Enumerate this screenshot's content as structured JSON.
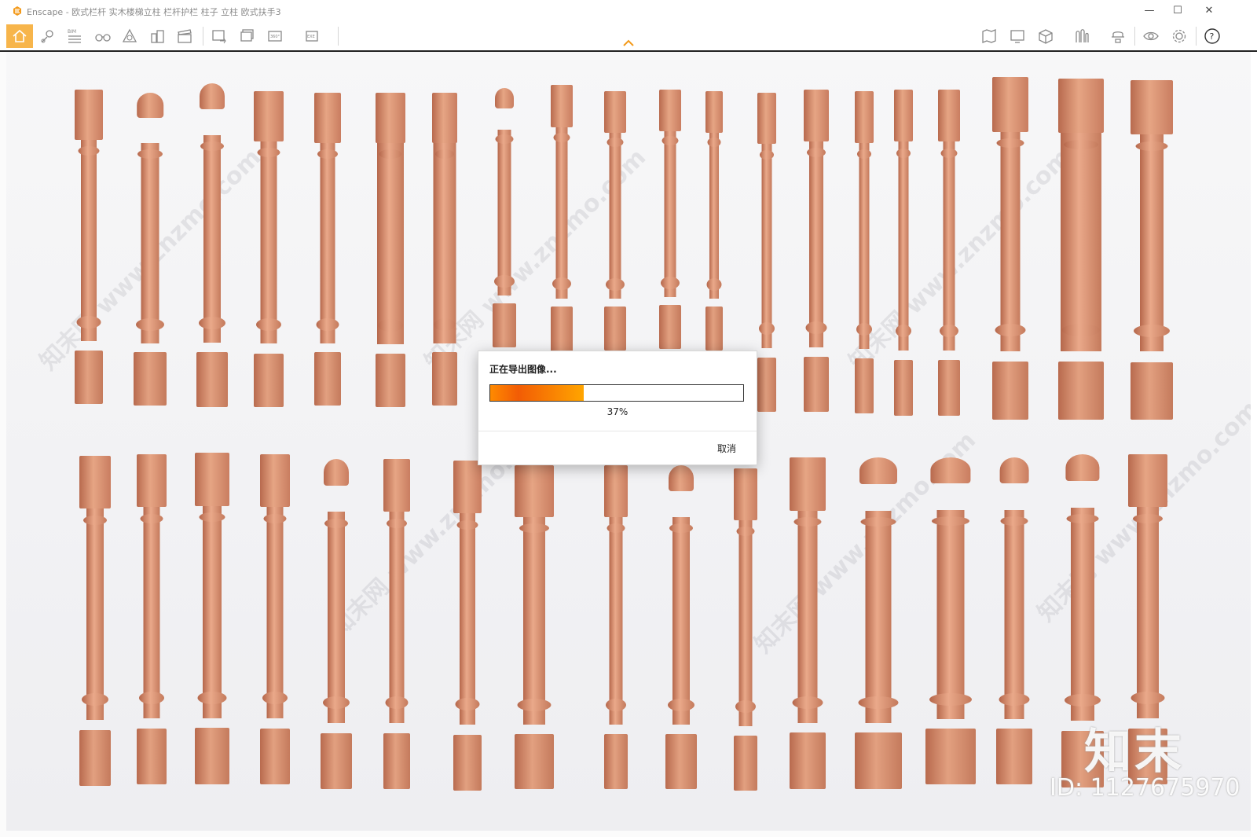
{
  "window": {
    "title": "Enscape - 欧式栏杆 实木楼梯立柱 栏杆护栏 柱子 立柱 欧式扶手3",
    "controls": [
      "—",
      "☐",
      "✕"
    ]
  },
  "toolbar": {
    "left_icons": [
      "home-icon",
      "location-pin-icon",
      "bim-icon",
      "binoculars-icon",
      "atmosphere-icon",
      "buildings-icon",
      "video-clapper-icon",
      "screenshot-icon",
      "batch-render-icon",
      "panorama-360-icon",
      "exe-export-icon"
    ],
    "bim_label": "BIM",
    "pano_label": "360°",
    "exe_label": "EXE",
    "right_icons": [
      "map-icon",
      "monitor-icon",
      "cube-icon",
      "asset-library-icon",
      "hat-icon",
      "eye-icon",
      "gear-icon",
      "help-icon"
    ],
    "help_label": "?"
  },
  "export_dialog": {
    "title": "正在导出图像...",
    "progress_percent": 37,
    "progress_text": "37%",
    "cancel_label": "取消"
  },
  "watermark": {
    "logo": "知末",
    "id_text": "ID: 1127675970",
    "site": "知末网 www.znzmo.com"
  },
  "colors": {
    "accent": "#f7b54b",
    "progress_start": "#ff8a00",
    "progress_end": "#ffa500",
    "wood": "#d98d6c"
  }
}
